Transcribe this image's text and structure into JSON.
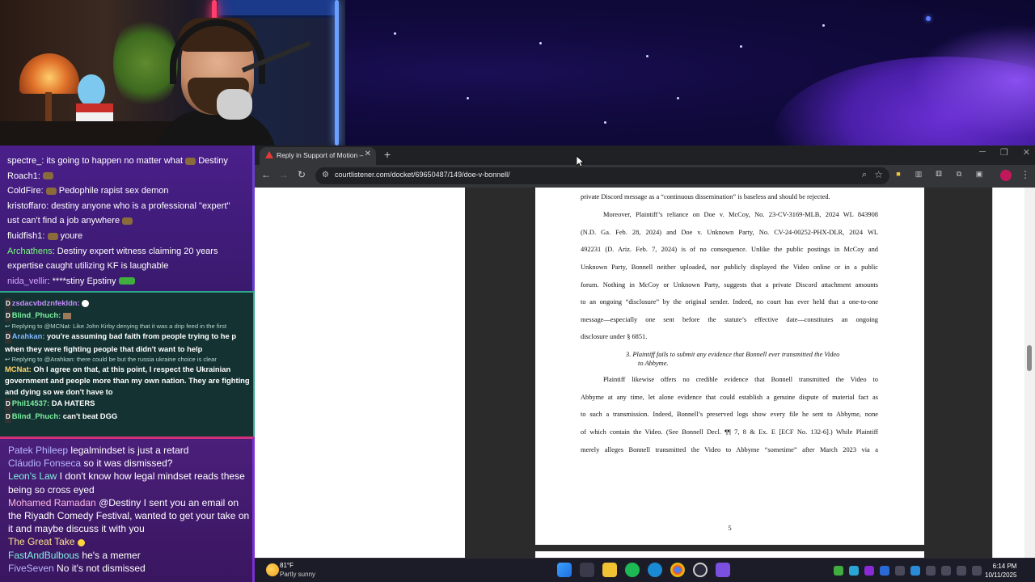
{
  "chat_top": [
    {
      "user": "spectre_",
      "text": ": its going to happen no matter what",
      "after_emote": " Destiny"
    },
    {
      "user": "Roach1",
      "text": ":"
    },
    {
      "user": "ColdFire",
      "text": ": ",
      "after_emote": " Pedophile rapist sex demon"
    },
    {
      "user": "kristoffaro",
      "text": ": destiny anyone who is a professional \"expert\""
    },
    {
      "user": "",
      "text": "ust can't find a job anywhere"
    },
    {
      "user": "fluidfish1",
      "text": ":",
      "after_emote": " youre"
    },
    {
      "user": "Archathens",
      "text": ": Destiny expert witness claiming 20 years"
    },
    {
      "user": "",
      "text": "expertise caught utilizing KF is laughable"
    },
    {
      "user": "nida_vellir",
      "text": ": ****stiny Epstiny"
    }
  ],
  "chat_middle": {
    "m1": {
      "badge": "D",
      "user": "zsdacvbdznfekldn:",
      "text": ""
    },
    "m2": {
      "badge": "D",
      "user": "Blind_Phuch:",
      "text": ""
    },
    "m3_reply": "↩ Replying to @MCNat: Like John Kirby denying that it was a drip feed in the first",
    "m4": {
      "badge": "D",
      "user": "Arahkan:",
      "text": " you're assuming bad faith from people trying to he p when they were fighting people that didn't want to help"
    },
    "m5_reply": "↩ Replying to @Arahkan: there could be but the russia ukraine choice is clear",
    "m6": {
      "user": "MCNat:",
      "text": " Oh I agree on that, at this point, I respect the Ukrainian government and people more than my own nation. They are fighting and dying so we don't have to"
    },
    "m7": {
      "badge": "D",
      "user": "Phil14537:",
      "text": " DA HATERS"
    },
    "m8": {
      "badge": "D",
      "user": "Blind_Phuch:",
      "text": " can't beat DGG"
    }
  },
  "chat_bottom": [
    {
      "user": "Patek Phileep",
      "text": " legalmindset is just a retard"
    },
    {
      "user": "Cláudio Fonseca",
      "text": " so it was dismissed?"
    },
    {
      "user": "Leon's Law",
      "text": " I don't know how legal mindset reads these being so cross eyed"
    },
    {
      "user": "Mohamed Ramadan",
      "text": " @Destiny I sent you an email on the Riyadh Comedy Festival, wanted to get your take on it and maybe discuss it with you"
    },
    {
      "user": "The Great Take",
      "text": ""
    },
    {
      "user": "FastAndBulbous",
      "text": " he's a memer"
    },
    {
      "user": "FiveSeven",
      "text": " No it's not dismissed"
    }
  ],
  "browser": {
    "tab_title": "Reply in Support of Motion – #",
    "url": "courtlistener.com/docket/69650487/149/doe-v-bonnell/"
  },
  "document": {
    "line0": "private Discord message as a “continuous dissemination” is baseless and should be rejected.",
    "p1": [
      "Moreover, Plaintiff’s reliance on Doe v. McCoy, No. 23-CV-3169-MLB, 2024 WL 843908",
      "(N.D. Ga. Feb. 28, 2024) and Doe v. Unknown Party, No. CV-24-00252-PHX-DLR, 2024 WL",
      "492231 (D. Ariz. Feb. 7, 2024) is of no consequence. Unlike the public postings in McCoy and",
      "Unknown Party, Bonnell neither uploaded, nor publicly displayed the Video online or in a public",
      "forum. Nothing in McCoy or Unknown Party, suggests that a private Discord attachment amounts",
      "to an ongoing “disclosure” by the original sender. Indeed, no court has ever held that a one-to-one",
      "message—especially one sent before the statute’s effective date—constitutes an ongoing",
      "disclosure under § 6851."
    ],
    "heading_1": "3.   Plaintiff fails to submit any evidence that Bonnell ever transmitted the Video",
    "heading_2": "to Abbyme.",
    "p2": [
      "Plaintiff likewise offers no credible evidence that Bonnell transmitted the Video to",
      "Abbyme at any time, let alone evidence that could establish a genuine dispute of material fact as",
      "to such a transmission. Indeed, Bonnell’s preserved logs show every file he sent to Abbyme, none",
      "of which contain the Video. (See Bonnell Decl. ¶¶ 7, 8 & Ex. E [ECF No. 132-6].) While Plaintiff",
      "merely alleges Bonnell transmitted the Video to Abbyme “sometime” after March 2023 via a"
    ],
    "page_number": "5"
  },
  "taskbar": {
    "temp": "81°F",
    "weather": "Partly sunny",
    "time": "6:14 PM",
    "date": "10/11/2025"
  }
}
